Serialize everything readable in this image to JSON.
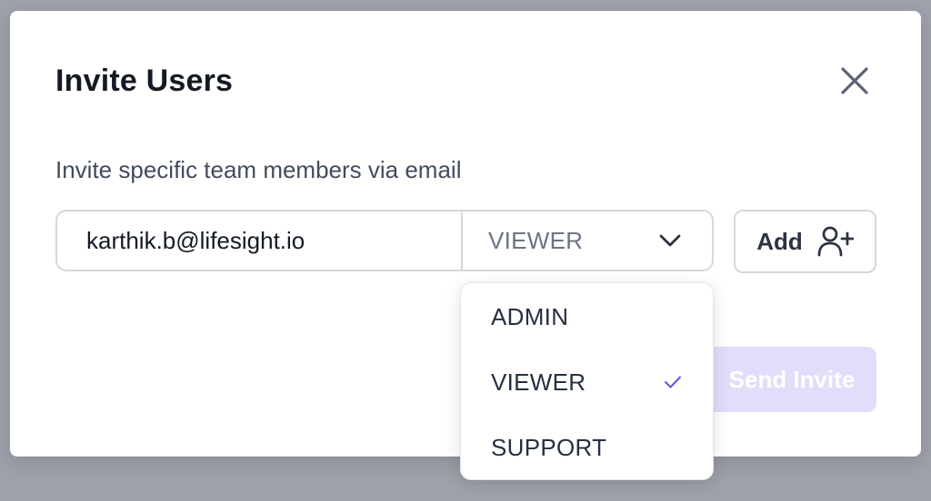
{
  "modal": {
    "title": "Invite Users",
    "subtitle": "Invite specific team members via email"
  },
  "invite_form": {
    "email_value": "karthik.b@lifesight.io",
    "selected_role": "VIEWER",
    "add_label": "Add",
    "send_label": "Send Invite"
  },
  "role_dropdown": {
    "options": [
      {
        "label": "ADMIN",
        "selected": false
      },
      {
        "label": "VIEWER",
        "selected": true
      },
      {
        "label": "SUPPORT",
        "selected": false
      }
    ]
  },
  "colors": {
    "accent": "#6d4ee0",
    "send_button_disabled_bg": "#e3dcfb",
    "backdrop": "#9fa2ab"
  },
  "icons": {
    "close": "close-icon",
    "dropdown": "chevron-down-icon",
    "add_user": "user-plus-icon",
    "selected": "check-icon"
  }
}
